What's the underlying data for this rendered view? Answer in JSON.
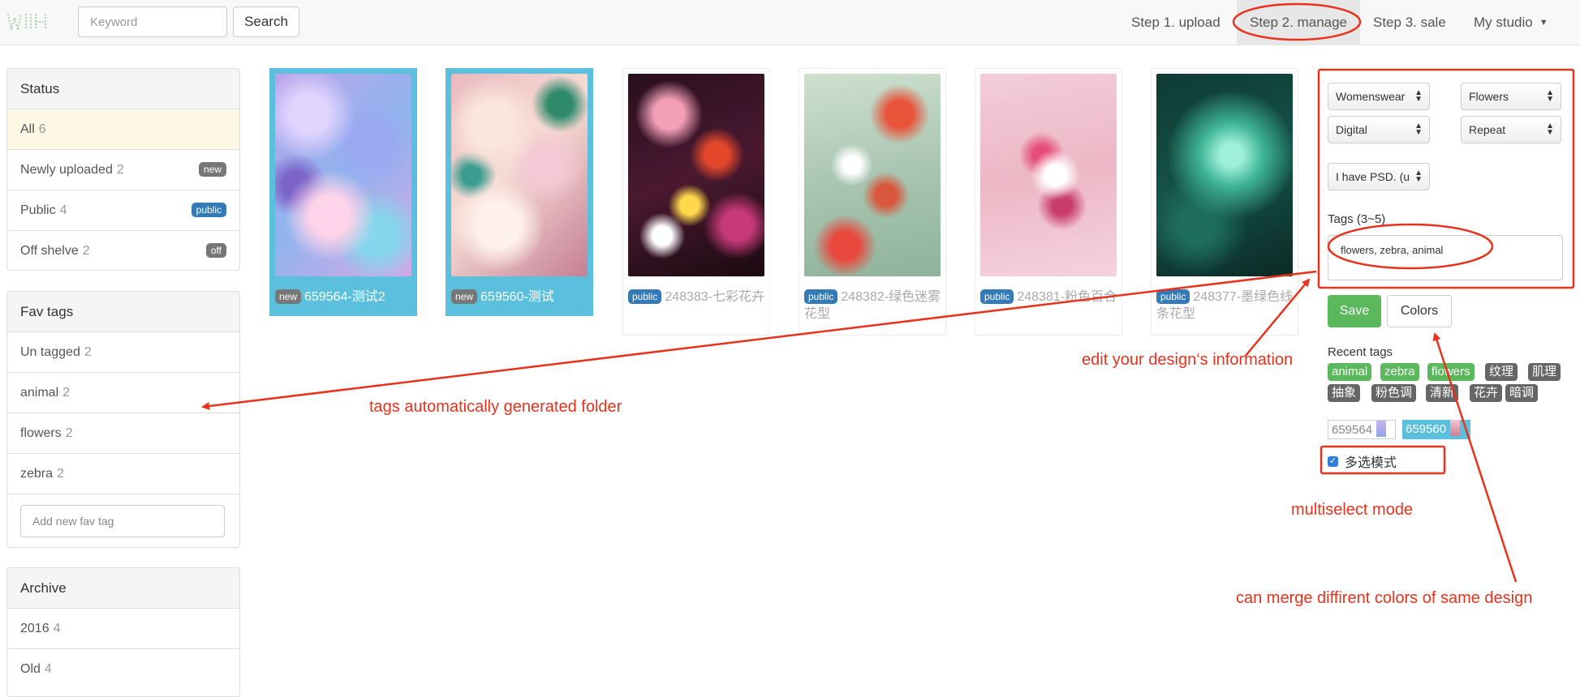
{
  "navbar": {
    "search_placeholder": "Keyword",
    "search_button": "Search",
    "links": {
      "upload": "Step 1. upload",
      "manage": "Step 2. manage",
      "sale": "Step 3. sale",
      "studio": "My studio"
    }
  },
  "sidebar": {
    "status": {
      "title": "Status",
      "items": [
        {
          "label": "All",
          "count": "6"
        },
        {
          "label": "Newly uploaded",
          "count": "2",
          "badge": "new"
        },
        {
          "label": "Public",
          "count": "4",
          "badge": "public"
        },
        {
          "label": "Off shelve",
          "count": "2",
          "badge": "off"
        }
      ]
    },
    "fav_tags": {
      "title": "Fav tags",
      "items": [
        {
          "label": "Un tagged",
          "count": "2"
        },
        {
          "label": "animal",
          "count": "2"
        },
        {
          "label": "flowers",
          "count": "2"
        },
        {
          "label": "zebra",
          "count": "2"
        }
      ],
      "add_placeholder": "Add new fav tag"
    },
    "archive": {
      "title": "Archive",
      "items": [
        {
          "label": "2016",
          "count": "4"
        },
        {
          "label": "Old",
          "count": "4"
        }
      ]
    }
  },
  "designs": [
    {
      "status": "new",
      "title": "659564-测试2",
      "selected": true
    },
    {
      "status": "new",
      "title": "659560-测试",
      "selected": true
    },
    {
      "status": "public",
      "title": "248383-七彩花卉",
      "selected": false
    },
    {
      "status": "public",
      "title": "248382-绿色迷雾花型",
      "selected": false
    },
    {
      "status": "public",
      "title": "248381-粉色百合",
      "selected": false
    },
    {
      "status": "public",
      "title": "248377-墨绿色线条花型",
      "selected": false
    }
  ],
  "edit_panel": {
    "selects": {
      "category": "Womenswear",
      "theme": "Flowers",
      "technique": "Digital",
      "layout": "Repeat",
      "psd": "I have PSD. (u"
    },
    "tags_label": "Tags (3~5)",
    "tags_value": "flowers, zebra, animal",
    "save_button": "Save",
    "colors_button": "Colors",
    "recent_tags_label": "Recent tags",
    "recent_tags": [
      {
        "label": "animal",
        "style": "green"
      },
      {
        "label": "zebra",
        "style": "green"
      },
      {
        "label": "flowers",
        "style": "green"
      },
      {
        "label": "纹理",
        "style": "gray"
      },
      {
        "label": "肌理",
        "style": "gray"
      },
      {
        "label": "抽象",
        "style": "gray"
      },
      {
        "label": "粉色调",
        "style": "gray"
      },
      {
        "label": "清新",
        "style": "gray"
      },
      {
        "label": "花卉",
        "style": "gray"
      },
      {
        "label": "暗调",
        "style": "gray"
      }
    ],
    "merge_items": [
      "659564",
      "659560"
    ],
    "multiselect_label": "多选模式",
    "multiselect_checked": true
  },
  "annotations": {
    "edit_info": "edit your design‘s information",
    "tags_folder": "tags automatically generated folder",
    "multiselect": "multiselect mode",
    "merge_colors": "can merge diffirent colors of same design"
  },
  "colors": {
    "annotation_red": "#e8321c",
    "selected_card": "#5bc0de",
    "save_green": "#5cb85c",
    "badge_blue": "#337ab7"
  }
}
